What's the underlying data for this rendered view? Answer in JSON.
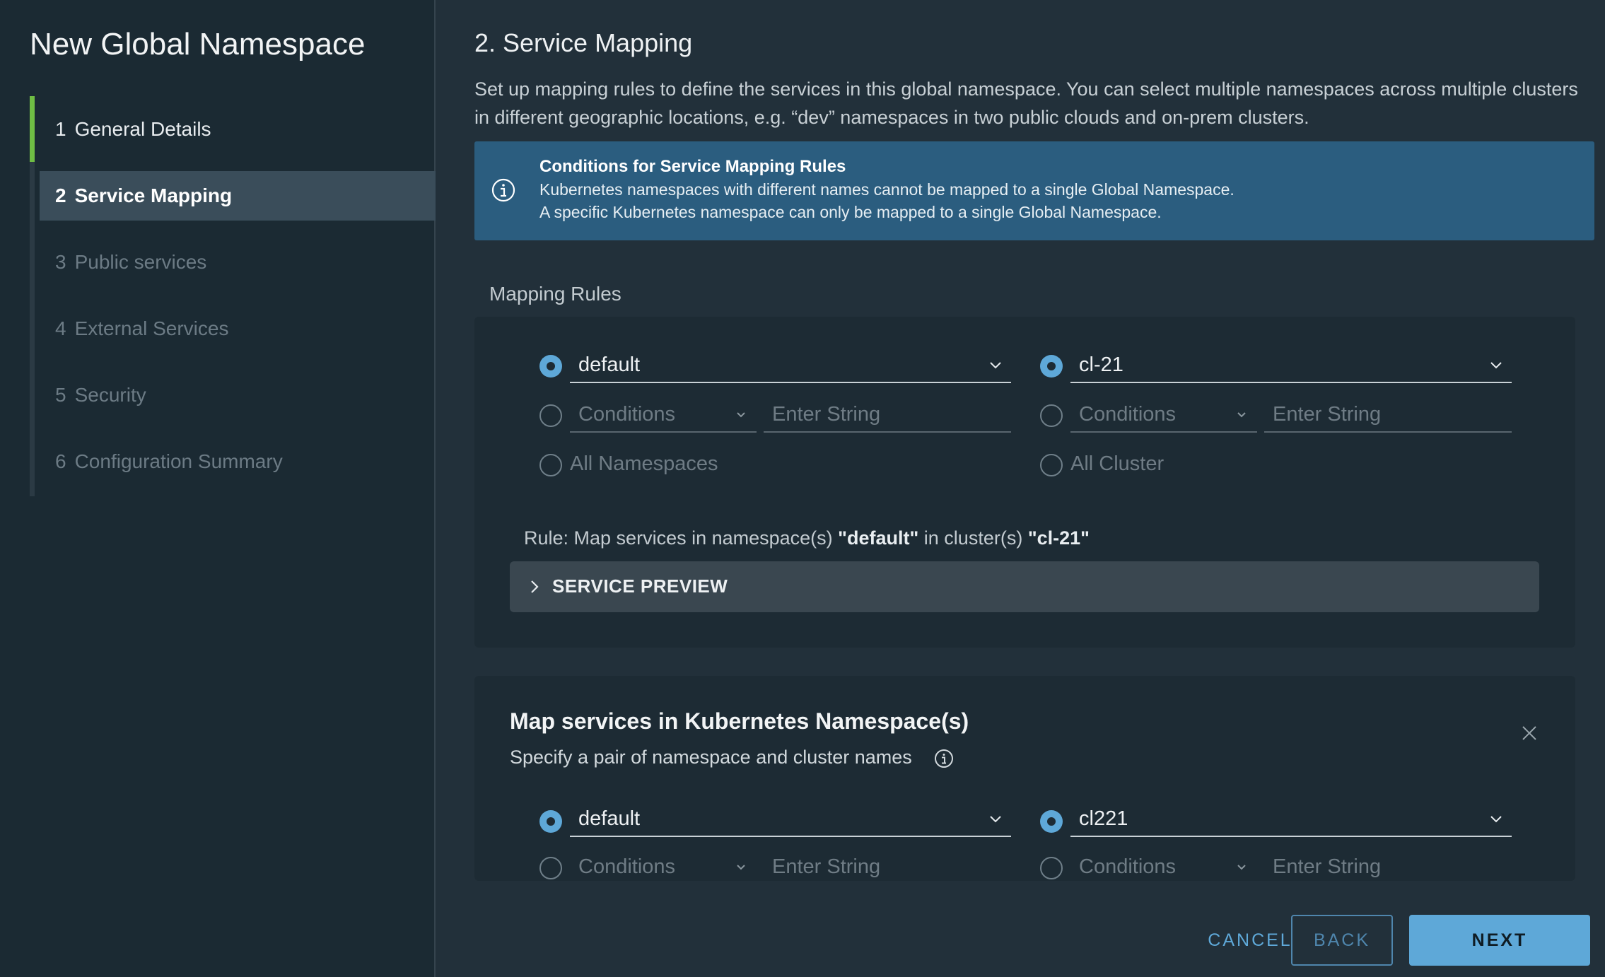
{
  "wizard": {
    "title": "New Global Namespace",
    "steps": [
      {
        "num": "1",
        "label": "General Details"
      },
      {
        "num": "2",
        "label": "Service Mapping"
      },
      {
        "num": "3",
        "label": "Public services"
      },
      {
        "num": "4",
        "label": "External Services"
      },
      {
        "num": "5",
        "label": "Security"
      },
      {
        "num": "6",
        "label": "Configuration Summary"
      }
    ]
  },
  "section": {
    "title": "2. Service Mapping",
    "description": "Set up mapping rules to define the services in this global namespace. You can select multiple namespaces across multiple clusters in different geographic locations, e.g. “dev” namespaces in two public clouds and on-prem clusters."
  },
  "info_banner": {
    "title": "Conditions for Service Mapping Rules",
    "line1": "Kubernetes namespaces with different names cannot be mapped to a single Global Namespace.",
    "line2": "A specific Kubernetes namespace can only be mapped to a single Global Namespace.",
    "icon": "info-icon"
  },
  "mapping_rules": {
    "label": "Mapping Rules",
    "rule1": {
      "namespace_value": "default",
      "cluster_value": "cl-21",
      "conditions_placeholder": "Conditions",
      "enter_string_placeholder": "Enter String",
      "all_namespaces_label": "All Namespaces",
      "all_cluster_label": "All Cluster",
      "rule_prefix": "Rule: Map services in namespace(s) ",
      "rule_namespace": "\"default\"",
      "rule_mid": " in cluster(s) ",
      "rule_cluster": "\"cl-21\"",
      "preview_label": "SERVICE PREVIEW"
    },
    "rule2": {
      "title": "Map services in Kubernetes Namespace(s)",
      "subtitle": "Specify a pair of namespace and cluster names",
      "namespace_value": "default",
      "cluster_value": "cl221",
      "conditions_placeholder": "Conditions",
      "enter_string_placeholder": "Enter String"
    }
  },
  "footer": {
    "cancel": "CANCEL",
    "back": "BACK",
    "next": "NEXT"
  },
  "colors": {
    "accent": "#5ea8d8",
    "step_complete": "#6fbd44",
    "banner": "#2b5d7f"
  }
}
